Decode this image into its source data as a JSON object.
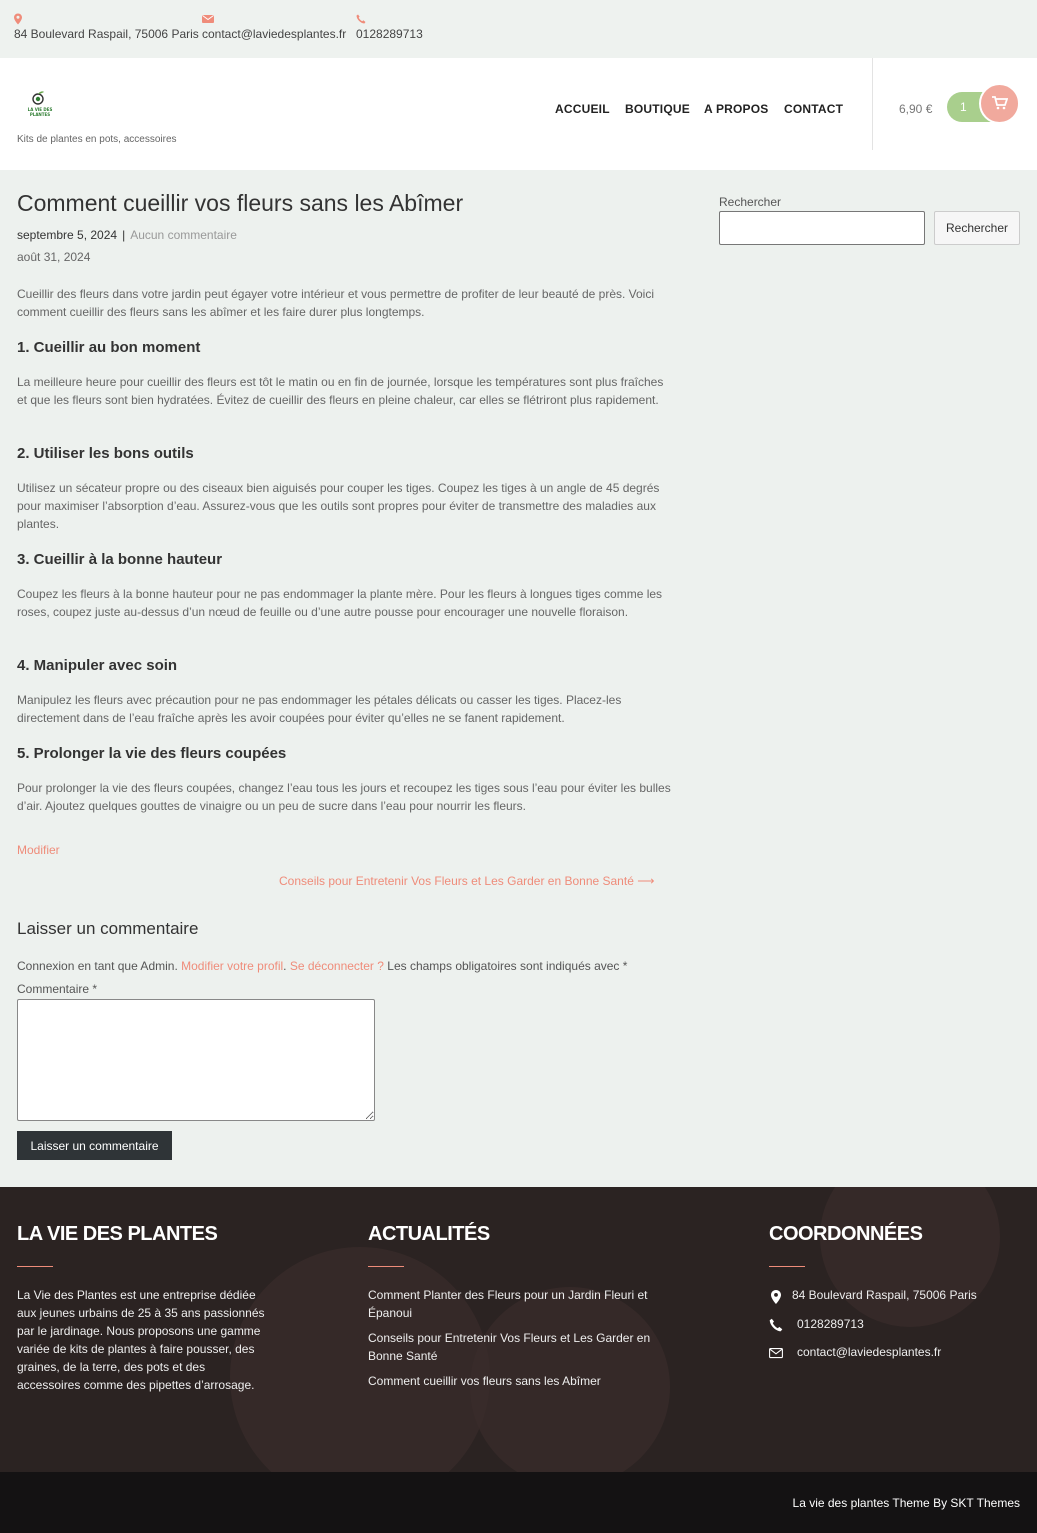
{
  "topbar": {
    "address": "84 Boulevard Raspail, 75006 Paris",
    "email": "contact@laviedesplantes.fr",
    "phone": "0128289713"
  },
  "header": {
    "logo_text": "LA VIE DES PLANTES",
    "tagline": "Kits de plantes en pots, accessoires",
    "nav": [
      "ACCUEIL",
      "BOUTIQUE",
      "A PROPOS",
      "CONTACT"
    ],
    "cart_total": "6,90 €",
    "cart_count": "1"
  },
  "post": {
    "title": "Comment cueillir vos fleurs sans les Abîmer",
    "date": "septembre 5, 2024",
    "separator": "|",
    "comments_link": "Aucun commentaire",
    "modified_date": "août 31, 2024",
    "intro": "Cueillir des fleurs dans votre jardin peut égayer votre intérieur et vous permettre de profiter de leur beauté de près. Voici comment cueillir des fleurs sans les abîmer et les faire durer plus longtemps.",
    "sections": [
      {
        "heading": "1. Cueillir au bon moment",
        "text": "La meilleure heure pour cueillir des fleurs est tôt le matin ou en fin de journée, lorsque les températures sont plus fraîches et que les fleurs sont bien hydratées. Évitez de cueillir des fleurs en pleine chaleur, car elles se flétriront plus rapidement."
      },
      {
        "heading": "2. Utiliser les bons outils",
        "text": "Utilisez un sécateur propre ou des ciseaux bien aiguisés pour couper les tiges. Coupez les tiges à un angle de 45 degrés pour maximiser l’absorption d’eau. Assurez-vous que les outils sont propres pour éviter de transmettre des maladies aux plantes."
      },
      {
        "heading": "3. Cueillir à la bonne hauteur",
        "text": "Coupez les fleurs à la bonne hauteur pour ne pas endommager la plante mère. Pour les fleurs à longues tiges comme les roses, coupez juste au-dessus d’un nœud de feuille ou d’une autre pousse pour encourager une nouvelle floraison."
      },
      {
        "heading": "4. Manipuler avec soin",
        "text": "Manipulez les fleurs avec précaution pour ne pas endommager les pétales délicats ou casser les tiges. Placez-les directement dans de l’eau fraîche après les avoir coupées pour éviter qu’elles ne se fanent rapidement."
      },
      {
        "heading": "5. Prolonger la vie des fleurs coupées",
        "text": "Pour prolonger la vie des fleurs coupées, changez l’eau tous les jours et recoupez les tiges sous l’eau pour éviter les bulles d’air. Ajoutez quelques gouttes de vinaigre ou un peu de sucre dans l’eau pour nourrir les fleurs."
      }
    ],
    "edit_link": "Modifier",
    "next_post": "Conseils pour Entretenir Vos Fleurs et Les Garder en Bonne Santé ⟶"
  },
  "comments": {
    "title": "Laisser un commentaire",
    "logged_in_prefix": "Connexion en tant que Admin.",
    "edit_profile": "Modifier votre profil",
    "logout": "Se déconnecter ?",
    "required_note": "Les champs obligatoires sont indiqués avec *",
    "comment_label": "Commentaire *",
    "submit_label": "Laisser un commentaire"
  },
  "sidebar": {
    "search_label": "Rechercher",
    "search_value": "",
    "search_button": "Rechercher"
  },
  "footer": {
    "about_title": "LA VIE DES PLANTES",
    "about_text": "La Vie des Plantes est une entreprise dédiée aux jeunes urbains de 25 à 35 ans passionnés par le jardinage. Nous proposons une gamme variée de kits de plantes à faire pousser, des graines, de la terre, des pots et des accessoires comme des pipettes d’arrosage.",
    "news_title": "ACTUALITÉS",
    "news": [
      "Comment Planter des Fleurs pour un Jardin Fleuri et Épanoui",
      "Conseils pour Entretenir Vos Fleurs et Les Garder en Bonne Santé",
      "Comment cueillir vos fleurs sans les Abîmer"
    ],
    "contact_title": "COORDONNÉES",
    "address": "84 Boulevard Raspail, 75006 Paris",
    "phone": "0128289713",
    "email": "contact@laviedesplantes.fr",
    "credit": "La vie des plantes Theme By SKT Themes"
  },
  "colors": {
    "accent": "#ef8c7a",
    "cart_green": "#a9cf8d",
    "cart_pink": "#f1a99d",
    "footer_bg": "#2b2322",
    "bottom_bg": "#141213"
  },
  "icons": {
    "address": "map-pin-icon",
    "email": "envelope-icon",
    "phone": "phone-icon",
    "cart": "shopping-cart-icon"
  }
}
